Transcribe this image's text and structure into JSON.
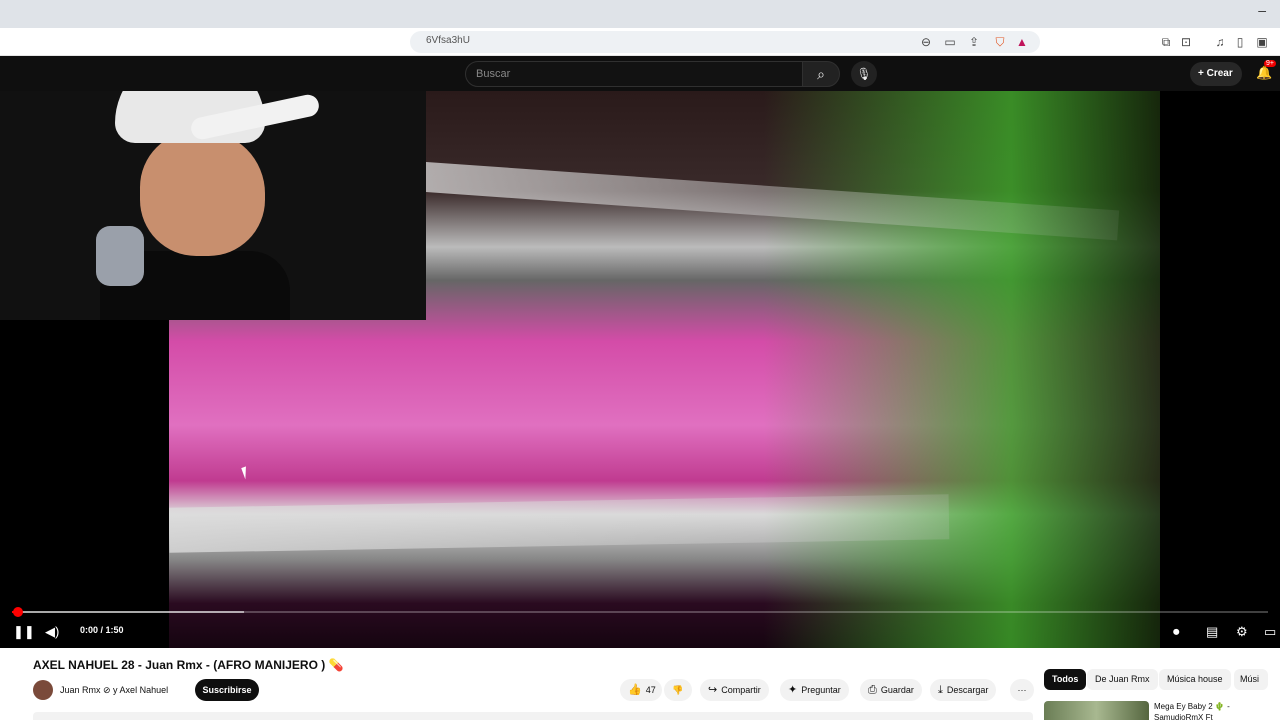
{
  "browser": {
    "url": "6Vfsa3hU",
    "minimize_glyph": "–",
    "toolbar_icons": [
      "zoom-icon",
      "cast-icon",
      "share-icon",
      "brave-shields-icon",
      "brave-rewards-icon",
      "extensions-icon",
      "screenshot-icon",
      "media-icon",
      "sidebar-icon",
      "wallet-icon"
    ]
  },
  "header": {
    "search_placeholder": "Buscar",
    "create_label": "Crear",
    "notification_badge": "9+"
  },
  "player": {
    "time": "0:00 / 1:50",
    "progress_played_fraction": 0.005,
    "progress_buffered_fraction": 0.185
  },
  "video": {
    "title": "AXEL NAHUEL 28 - Juan Rmx - (AFRO MANIJERO ) 💊",
    "channel": "Juan Rmx ⊘ y Axel Nahuel",
    "subscribe_label": "Suscribirse",
    "likes": "47",
    "share_label": "Compartir",
    "ask_label": "Preguntar",
    "save_label": "Guardar",
    "download_label": "Descargar",
    "more_glyph": "···"
  },
  "chips": [
    {
      "label": "Todos",
      "active": true
    },
    {
      "label": "De Juan Rmx",
      "active": false
    },
    {
      "label": "Música house",
      "active": false
    },
    {
      "label": "Músi",
      "active": false
    }
  ],
  "recommendation": {
    "title": "Mega Ey Baby 2 🌵 - SamudioRmX Ft"
  },
  "colors": {
    "accent_red": "#ff0000",
    "yt_dark": "#0f0f0f"
  }
}
